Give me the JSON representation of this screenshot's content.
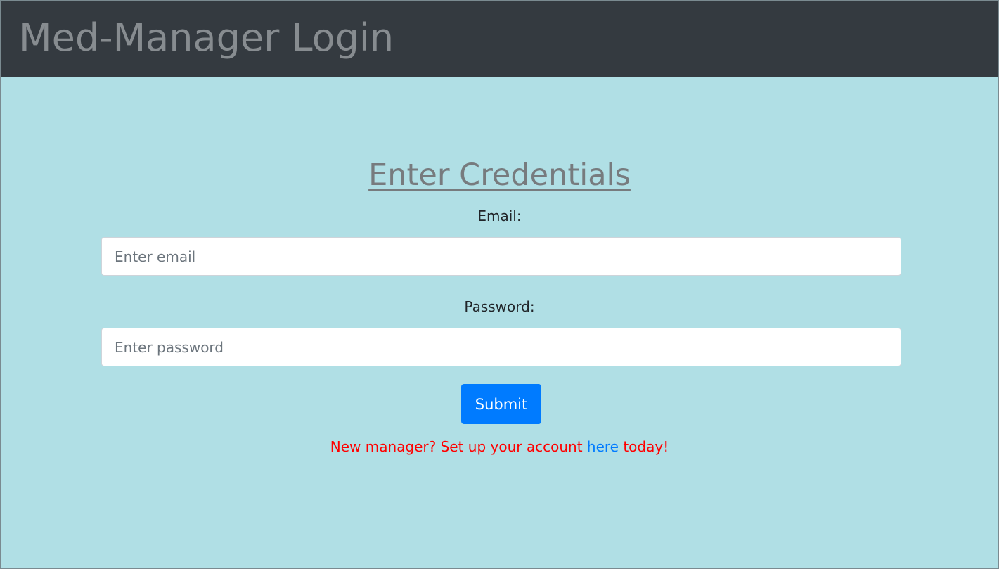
{
  "header": {
    "title": "Med-Manager Login"
  },
  "form": {
    "heading": "Enter Credentials",
    "email": {
      "label": "Email:",
      "value": "",
      "placeholder": "Enter email"
    },
    "password": {
      "label": "Password:",
      "value": "",
      "placeholder": "Enter password"
    },
    "submit_label": "Submit",
    "signup": {
      "prefix": "New manager? Set up your account ",
      "link_text": "here",
      "suffix": " today!"
    }
  },
  "colors": {
    "header_bg": "#343a40",
    "page_bg": "#b0dfe5",
    "primary": "#007bff",
    "signup_text": "#ff0000"
  }
}
